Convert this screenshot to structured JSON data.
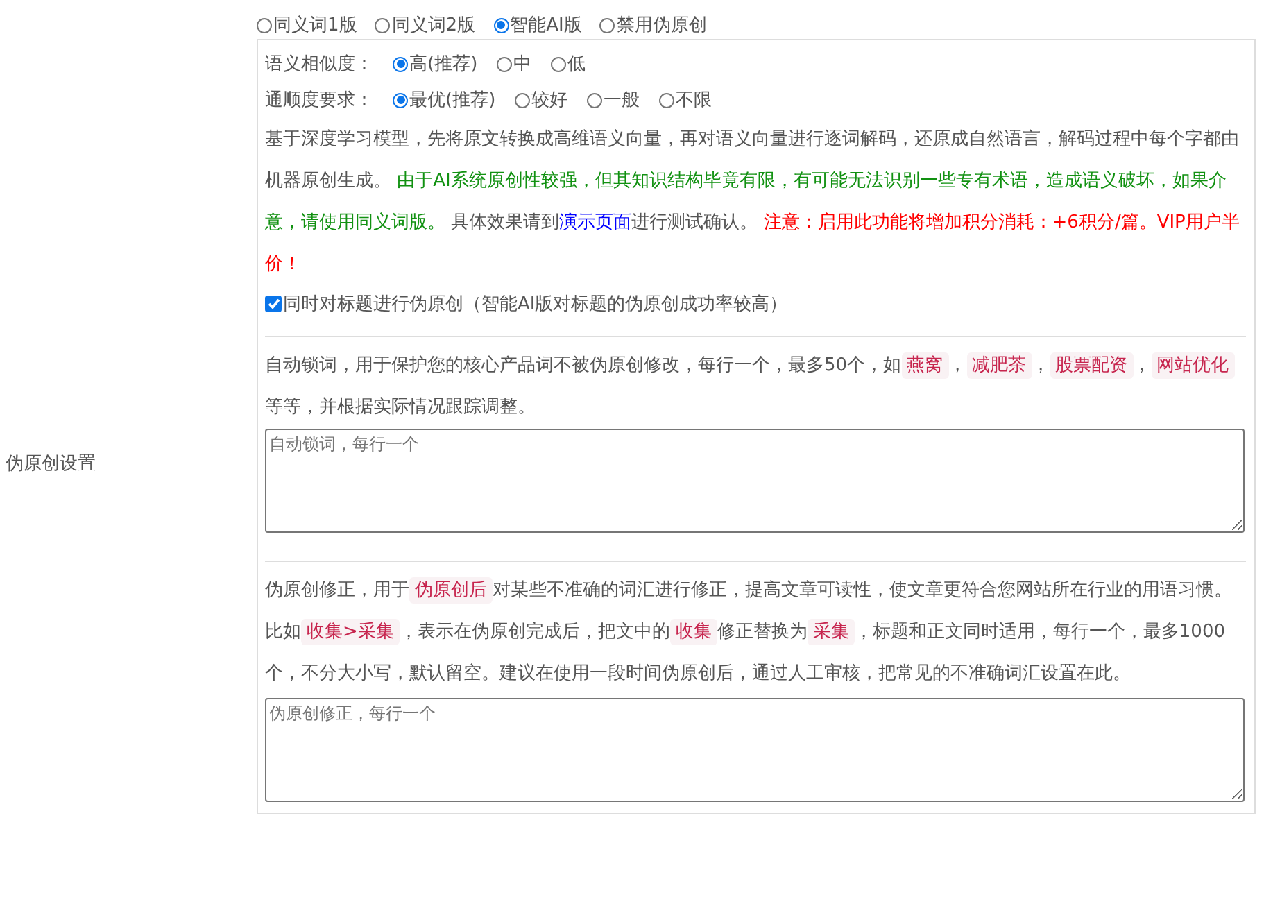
{
  "version_options": [
    {
      "label": "同义词1版",
      "selected": false
    },
    {
      "label": "同义词2版",
      "selected": false
    },
    {
      "label": "智能AI版",
      "selected": true
    },
    {
      "label": "禁用伪原创",
      "selected": false
    }
  ],
  "settings_label": "伪原创设置",
  "similarity": {
    "label": "语义相似度：",
    "options": [
      {
        "label": "高(推荐)",
        "selected": true
      },
      {
        "label": "中",
        "selected": false
      },
      {
        "label": "低",
        "selected": false
      }
    ]
  },
  "fluency": {
    "label": "通顺度要求：",
    "options": [
      {
        "label": "最优(推荐)",
        "selected": true
      },
      {
        "label": "较好",
        "selected": false
      },
      {
        "label": "一般",
        "selected": false
      },
      {
        "label": "不限",
        "selected": false
      }
    ]
  },
  "description": [
    {
      "kind": "plain",
      "text": "基于深度学习模型，先将原文转换成高维语义向量，再对语义向量进行逐词解码，还原成自然语言，解码过程中每个字都由机器原创生成。 "
    },
    {
      "kind": "note",
      "text": "由于AI系统原创性较强，但其知识结构毕竟有限，有可能无法识别一些专有术语，造成语义破坏，如果介意，请使用同义词版。"
    },
    {
      "kind": "plain",
      "text": " 具体效果请到"
    },
    {
      "kind": "link",
      "text": "演示页面"
    },
    {
      "kind": "plain",
      "text": "进行测试确认。 "
    },
    {
      "kind": "warning",
      "text": "注意：启用此功能将增加积分消耗：+6积分/篇。VIP用户半价！"
    }
  ],
  "title_option": {
    "label": "同时对标题进行伪原创（智能AI版对标题的伪原创成功率较高）",
    "checked": true
  },
  "lock_words": {
    "description": [
      {
        "kind": "plain",
        "text": "自动锁词，用于保护您的核心产品词不被伪原创修改，每行一个，最多50个，如"
      },
      {
        "kind": "tag",
        "text": "燕窝"
      },
      {
        "kind": "plain",
        "text": "，"
      },
      {
        "kind": "tag",
        "text": "减肥茶"
      },
      {
        "kind": "plain",
        "text": "，"
      },
      {
        "kind": "tag",
        "text": "股票配资"
      },
      {
        "kind": "plain",
        "text": "，"
      },
      {
        "kind": "tag",
        "text": "网站优化"
      },
      {
        "kind": "plain",
        "text": " 等等，并根据实际情况跟踪调整。"
      }
    ],
    "placeholder": "自动锁词，每行一个"
  },
  "correction": {
    "description": [
      {
        "kind": "plain",
        "text": "伪原创修正，用于"
      },
      {
        "kind": "tag",
        "text": "伪原创后"
      },
      {
        "kind": "plain",
        "text": "对某些不准确的词汇进行修正，提高文章可读性，使文章更符合您网站所在行业的用语习惯。比如"
      },
      {
        "kind": "tag",
        "text": "收集>采集"
      },
      {
        "kind": "plain",
        "text": "，表示在伪原创完成后，把文中的"
      },
      {
        "kind": "tag",
        "text": "收集"
      },
      {
        "kind": "plain",
        "text": "修正替换为"
      },
      {
        "kind": "tag",
        "text": "采集"
      },
      {
        "kind": "plain",
        "text": "，标题和正文同时适用，每行一个，最多1000个，不分大小写，默认留空。建议在使用一段时间伪原创后，通过人工审核，把常见的不准确词汇设置在此。"
      }
    ],
    "placeholder": "伪原创修正，每行一个"
  }
}
